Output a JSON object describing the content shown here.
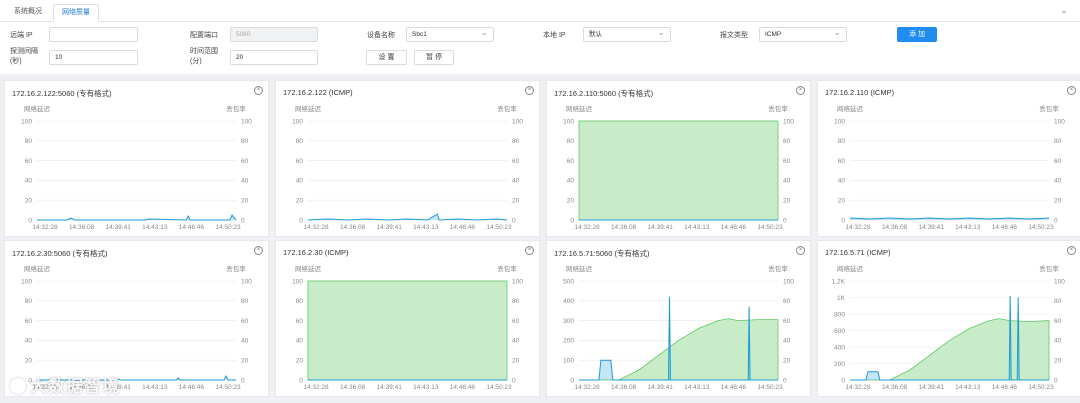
{
  "tabs": [
    {
      "label": "系统概况"
    },
    {
      "label": "网络质量"
    }
  ],
  "form": {
    "remote_ip": {
      "label": "远端 IP",
      "value": ""
    },
    "config_port": {
      "label": "配置端口",
      "value": "5060"
    },
    "device_name": {
      "label": "设备名称",
      "value": "Sbc1"
    },
    "local_ip": {
      "label": "本地 IP",
      "value": "默认"
    },
    "message_type": {
      "label": "报文类型",
      "value": "ICMP"
    },
    "add_button": "添 加",
    "probe_interval": {
      "label_line1": "探测间隔",
      "label_line2": "(秒)",
      "value": "10"
    },
    "time_range": {
      "label_line1": "时间范围",
      "label_line2": "(分)",
      "value": "20"
    },
    "set_button": "设 置",
    "pause_button": "暂 停"
  },
  "chart_common": {
    "left_axis_label": "网络延迟",
    "right_axis_label": "丢包率",
    "x_ticks": [
      "14:32:28",
      "14:36:08",
      "14:39:41",
      "14:43:13",
      "14:46:46",
      "14:50:23"
    ],
    "colors": {
      "line": "#1a9bd7",
      "area": "#c8ecc8",
      "area_line": "#5ec85e"
    }
  },
  "chart_data": [
    {
      "type": "area",
      "title": "172.16.2.122:5060 (专有格式)",
      "y_ticks": [
        "100",
        "80",
        "60",
        "40",
        "20",
        "0"
      ],
      "right_ticks": [
        "100",
        "80",
        "60",
        "40",
        "20",
        "0"
      ],
      "ylim": [
        0,
        100
      ],
      "loss_fill": 0,
      "latency": [
        [
          0,
          0
        ],
        [
          0.15,
          0
        ],
        [
          0.17,
          2
        ],
        [
          0.19,
          0
        ],
        [
          0.55,
          0
        ],
        [
          0.56,
          1
        ],
        [
          0.75,
          0
        ],
        [
          0.76,
          4
        ],
        [
          0.77,
          0
        ],
        [
          0.9,
          0
        ],
        [
          0.97,
          0
        ],
        [
          0.98,
          5
        ],
        [
          1,
          0
        ]
      ]
    },
    {
      "type": "area",
      "title": "172.16.2.122 (ICMP)",
      "y_ticks": [
        "100",
        "80",
        "60",
        "40",
        "20",
        "0"
      ],
      "right_ticks": [
        "100",
        "80",
        "60",
        "40",
        "20",
        "0"
      ],
      "ylim": [
        0,
        100
      ],
      "loss_fill": 0,
      "latency": [
        [
          0,
          0
        ],
        [
          0.1,
          1
        ],
        [
          0.2,
          0
        ],
        [
          0.3,
          1
        ],
        [
          0.4,
          0
        ],
        [
          0.5,
          1
        ],
        [
          0.6,
          0
        ],
        [
          0.65,
          6
        ],
        [
          0.66,
          0
        ],
        [
          0.75,
          1
        ],
        [
          0.85,
          0
        ],
        [
          0.95,
          1
        ],
        [
          1,
          0
        ]
      ]
    },
    {
      "type": "area",
      "title": "172.16.2.110:5060 (专有格式)",
      "y_ticks": [
        "100",
        "80",
        "60",
        "40",
        "20",
        "0"
      ],
      "right_ticks": [
        "100",
        "80",
        "60",
        "40",
        "20",
        "0"
      ],
      "ylim": [
        0,
        100
      ],
      "loss_fill": 100,
      "latency": [
        [
          0,
          0
        ],
        [
          1,
          0
        ]
      ]
    },
    {
      "type": "area",
      "title": "172.16.2.110 (ICMP)",
      "y_ticks": [
        "100",
        "80",
        "60",
        "40",
        "20",
        "0"
      ],
      "right_ticks": [
        "100",
        "80",
        "60",
        "40",
        "20",
        "0"
      ],
      "ylim": [
        0,
        100
      ],
      "loss_fill": 0,
      "latency": [
        [
          0,
          2
        ],
        [
          0.1,
          1
        ],
        [
          0.2,
          2
        ],
        [
          0.3,
          1
        ],
        [
          0.4,
          2
        ],
        [
          0.5,
          1
        ],
        [
          0.6,
          2
        ],
        [
          0.7,
          1
        ],
        [
          0.8,
          2
        ],
        [
          0.9,
          1
        ],
        [
          1,
          2
        ]
      ]
    },
    {
      "type": "area",
      "title": "172.16.2.30:5060 (专有格式)",
      "y_ticks": [
        "100",
        "80",
        "60",
        "40",
        "20",
        "0"
      ],
      "right_ticks": [
        "100",
        "80",
        "60",
        "40",
        "20",
        "0"
      ],
      "ylim": [
        0,
        100
      ],
      "loss_fill": 0,
      "latency": [
        [
          0,
          0
        ],
        [
          0.4,
          0
        ],
        [
          0.41,
          1
        ],
        [
          0.42,
          0
        ],
        [
          0.7,
          0
        ],
        [
          0.71,
          2
        ],
        [
          0.72,
          0
        ],
        [
          0.94,
          0
        ],
        [
          0.95,
          4
        ],
        [
          0.96,
          0
        ],
        [
          1,
          0
        ]
      ]
    },
    {
      "type": "area",
      "title": "172.16.2.30 (ICMP)",
      "y_ticks": [
        "100",
        "80",
        "60",
        "40",
        "20",
        "0"
      ],
      "right_ticks": [
        "100",
        "80",
        "60",
        "40",
        "20",
        "0"
      ],
      "ylim": [
        0,
        100
      ],
      "loss_fill": 100,
      "latency": [
        [
          0,
          0
        ],
        [
          1,
          0
        ]
      ]
    },
    {
      "type": "area",
      "title": "172.16.5.71:5060 (专有格式)",
      "y_ticks": [
        "500",
        "400",
        "300",
        "200",
        "100",
        "0"
      ],
      "right_ticks": [
        "100",
        "80",
        "60",
        "40",
        "20",
        "0"
      ],
      "ylim": [
        0,
        500
      ],
      "loss_curve": [
        [
          0,
          0
        ],
        [
          0.2,
          0
        ],
        [
          0.3,
          10
        ],
        [
          0.4,
          25
        ],
        [
          0.5,
          40
        ],
        [
          0.6,
          52
        ],
        [
          0.7,
          60
        ],
        [
          0.75,
          62
        ],
        [
          0.8,
          60
        ],
        [
          0.9,
          61
        ],
        [
          1,
          61
        ]
      ],
      "latency": [
        [
          0,
          0
        ],
        [
          0.1,
          0
        ],
        [
          0.11,
          100
        ],
        [
          0.16,
          100
        ],
        [
          0.17,
          0
        ],
        [
          0.45,
          0
        ],
        [
          0.455,
          420
        ],
        [
          0.46,
          0
        ],
        [
          0.85,
          0
        ],
        [
          0.855,
          370
        ],
        [
          0.86,
          0
        ],
        [
          1,
          0
        ]
      ]
    },
    {
      "type": "area",
      "title": "172.16.5.71 (ICMP)",
      "y_ticks": [
        "1.2K",
        "1K",
        "800",
        "600",
        "400",
        "200",
        "0"
      ],
      "right_ticks": [
        "100",
        "80",
        "60",
        "40",
        "20",
        "0"
      ],
      "ylim": [
        0,
        1200
      ],
      "loss_curve": [
        [
          0,
          0
        ],
        [
          0.2,
          0
        ],
        [
          0.3,
          10
        ],
        [
          0.4,
          25
        ],
        [
          0.5,
          40
        ],
        [
          0.6,
          52
        ],
        [
          0.7,
          60
        ],
        [
          0.75,
          62
        ],
        [
          0.8,
          60
        ],
        [
          0.9,
          59
        ],
        [
          1,
          60
        ]
      ],
      "latency": [
        [
          0,
          0
        ],
        [
          0.08,
          0
        ],
        [
          0.09,
          100
        ],
        [
          0.14,
          100
        ],
        [
          0.15,
          0
        ],
        [
          0.8,
          0
        ],
        [
          0.805,
          1020
        ],
        [
          0.81,
          0
        ],
        [
          0.84,
          0
        ],
        [
          0.845,
          1000
        ],
        [
          0.85,
          0
        ],
        [
          1,
          0
        ]
      ]
    }
  ],
  "watermark": "大数据智境"
}
